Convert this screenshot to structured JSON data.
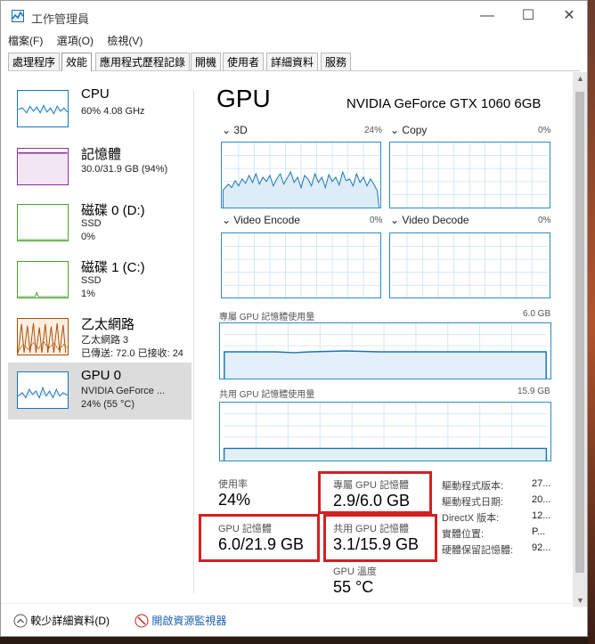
{
  "window": {
    "title": "工作管理員"
  },
  "menu": [
    "檔案(F)",
    "選項(O)",
    "檢視(V)"
  ],
  "tabs": [
    "處理程序",
    "效能",
    "應用程式歷程記錄",
    "開機",
    "使用者",
    "詳細資料",
    "服務"
  ],
  "active_tab": "效能",
  "sidebar": [
    {
      "title": "CPU",
      "line1": "60%  4.08 GHz",
      "line2": "",
      "color": "#1777b5",
      "icon": "cpu-graph-icon"
    },
    {
      "title": "記憶體",
      "line1": "30.0/31.9 GB (94%)",
      "line2": "",
      "color": "#8b2c9e",
      "icon": "memory-graph-icon"
    },
    {
      "title": "磁碟 0 (D:)",
      "line1": "SSD",
      "line2": "0%",
      "color": "#4aa02c",
      "icon": "disk-graph-icon"
    },
    {
      "title": "磁碟 1 (C:)",
      "line1": "SSD",
      "line2": "1%",
      "color": "#4aa02c",
      "icon": "disk-graph-icon"
    },
    {
      "title": "乙太網路",
      "line1": "乙太網路 3",
      "line2": "已傳送: 72.0 已接收: 24",
      "color": "#a74f01",
      "icon": "network-graph-icon"
    },
    {
      "title": "GPU 0",
      "line1": "NVIDIA GeForce ...",
      "line2": "24% (55 °C)",
      "color": "#1777b5",
      "icon": "gpu-graph-icon"
    }
  ],
  "selected_index": 5,
  "gpu": {
    "heading": "GPU",
    "name": "NVIDIA GeForce GTX 1060 6GB",
    "engines": [
      {
        "label": "3D",
        "pct": "24%"
      },
      {
        "label": "Copy",
        "pct": "0%"
      },
      {
        "label": "Video Encode",
        "pct": "0%"
      },
      {
        "label": "Video Decode",
        "pct": "0%"
      }
    ],
    "dedicated_label": "專屬 GPU 記憶體使用量",
    "dedicated_max": "6.0 GB",
    "shared_label": "共用 GPU 記憶體使用量",
    "shared_max": "15.9 GB"
  },
  "stats": {
    "usage_label": "使用率",
    "usage_value": "24%",
    "dedicated_label": "專屬 GPU 記憶體",
    "dedicated_value": "2.9/6.0 GB",
    "gpu_mem_label": "GPU 記憶體",
    "gpu_mem_value": "6.0/21.9 GB",
    "shared_label": "共用 GPU 記憶體",
    "shared_value": "3.1/15.9 GB",
    "temp_label": "GPU 溫度",
    "temp_value": "55 °C"
  },
  "info": [
    {
      "label": "驅動程式版本:",
      "value": "27..."
    },
    {
      "label": "驅動程式日期:",
      "value": "20..."
    },
    {
      "label": "DirectX 版本:",
      "value": "12..."
    },
    {
      "label": "實體位置:",
      "value": "P..."
    },
    {
      "label": "硬體保留記憶體:",
      "value": "92..."
    }
  ],
  "footer": {
    "fewer_details": "較少詳細資料(D)",
    "resource_monitor": "開啟資源監視器"
  }
}
